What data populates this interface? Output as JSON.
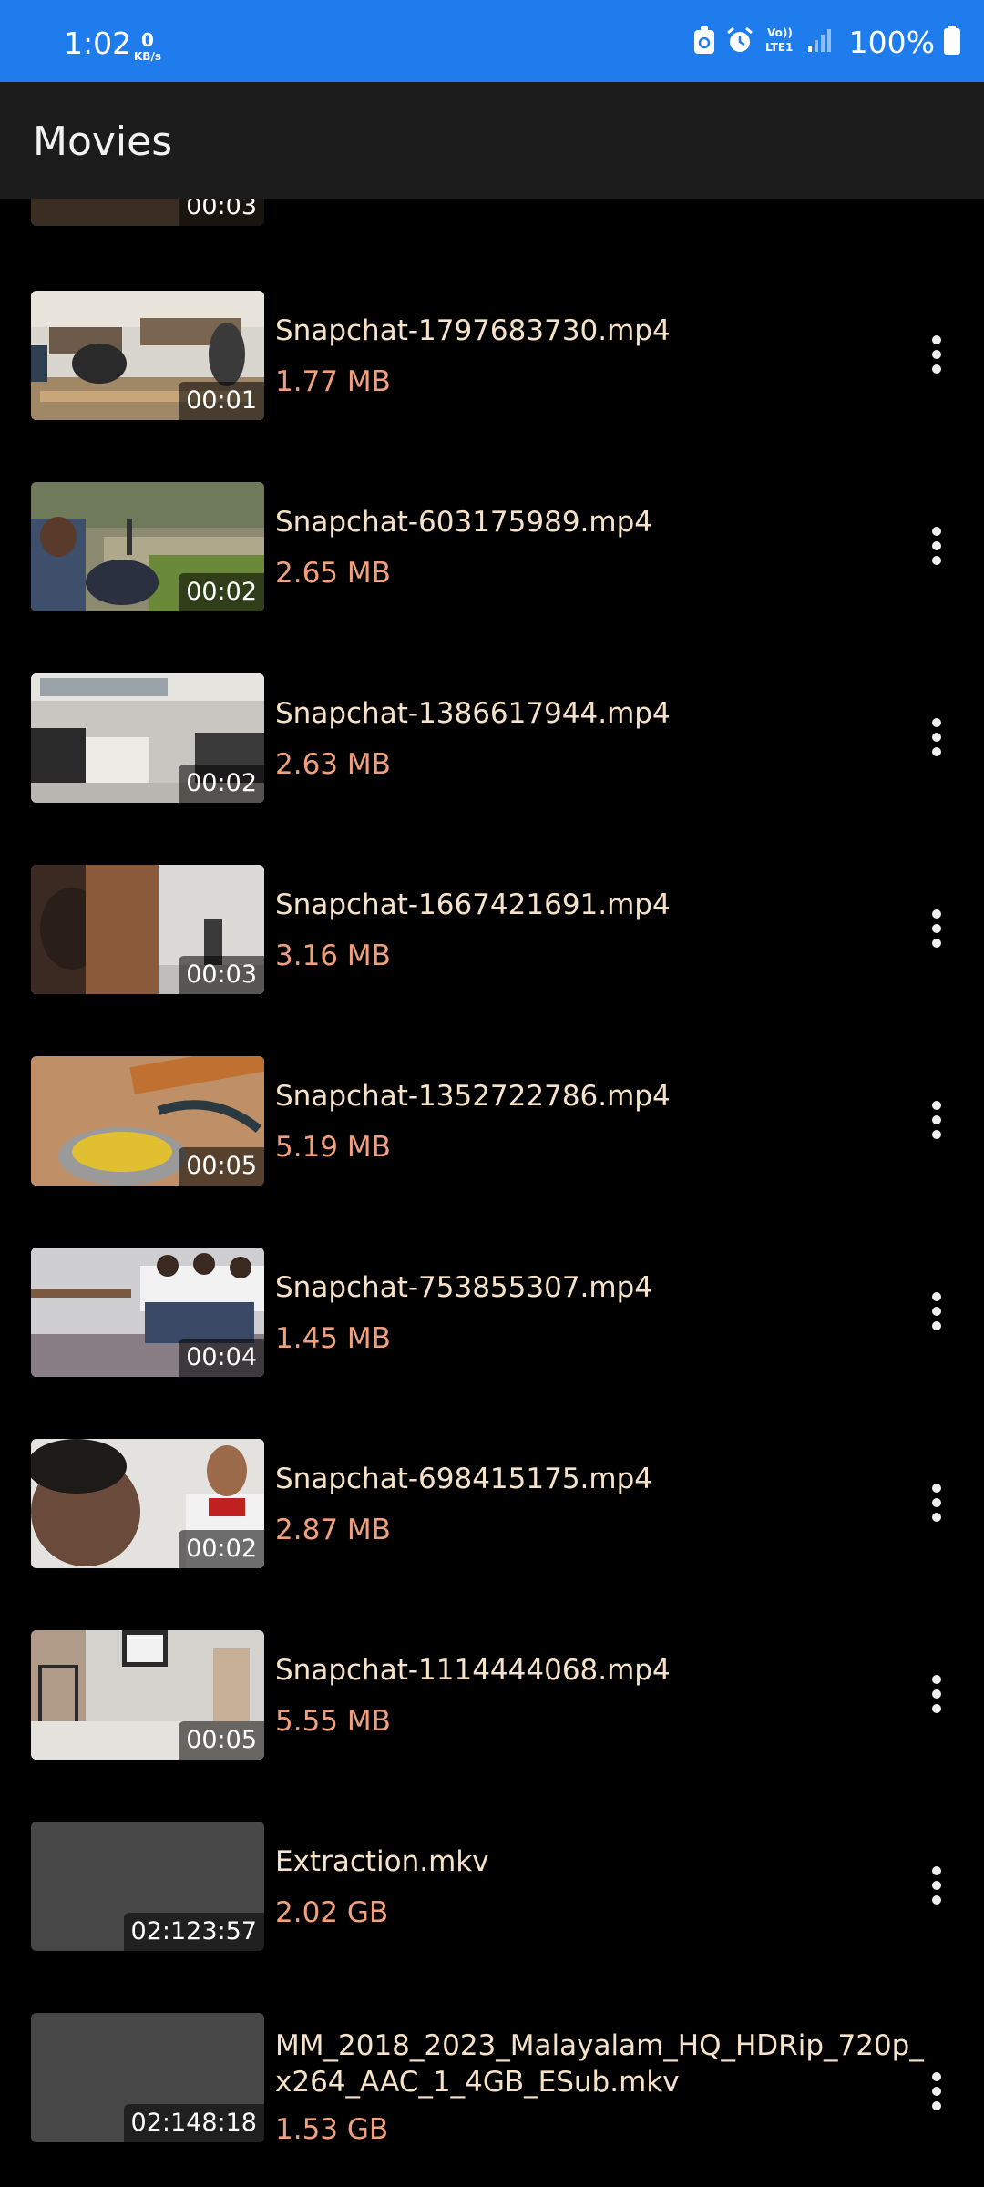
{
  "status_bar": {
    "time": "1:02",
    "net_speed_value": "0",
    "net_speed_unit": "KB/s",
    "network_label": "Vo)) LTE1",
    "battery": "100%"
  },
  "app_bar": {
    "title": "Movies"
  },
  "partial_top_item": {
    "duration": "00:03"
  },
  "videos": [
    {
      "name": "Snapchat-1797683730.mp4",
      "size": "1.77 MB",
      "duration": "00:01",
      "thumb": "classroom-desks"
    },
    {
      "name": "Snapchat-603175989.mp4",
      "size": "2.65 MB",
      "duration": "00:02",
      "thumb": "outdoor-crowd"
    },
    {
      "name": "Snapchat-1386617944.mp4",
      "size": "2.63 MB",
      "duration": "00:02",
      "thumb": "empty-classroom"
    },
    {
      "name": "Snapchat-1667421691.mp4",
      "size": "3.16 MB",
      "duration": "00:03",
      "thumb": "people-closeup"
    },
    {
      "name": "Snapchat-1352722786.mp4",
      "size": "5.19 MB",
      "duration": "00:05",
      "thumb": "food-bowl"
    },
    {
      "name": "Snapchat-753855307.mp4",
      "size": "1.45 MB",
      "duration": "00:04",
      "thumb": "students-group"
    },
    {
      "name": "Snapchat-698415175.mp4",
      "size": "2.87 MB",
      "duration": "00:02",
      "thumb": "selfie"
    },
    {
      "name": "Snapchat-1114444068.mp4",
      "size": "5.55 MB",
      "duration": "00:05",
      "thumb": "hallway"
    },
    {
      "name": "Extraction.mkv",
      "size": "2.02 GB",
      "duration": "02:123:57",
      "thumb": "placeholder"
    },
    {
      "name": "MM_2018_2023_Malayalam_HQ_HDRip_720p_x264_AAC_1_4GB_ESub.mkv",
      "size": "1.53 GB",
      "duration": "02:148:18",
      "thumb": "placeholder"
    }
  ],
  "colors": {
    "status_bar": "#1f7cec",
    "app_bar": "#1c1c1c",
    "background": "#000000",
    "file_name": "#f6e2c8",
    "file_size": "#f0a07e"
  }
}
